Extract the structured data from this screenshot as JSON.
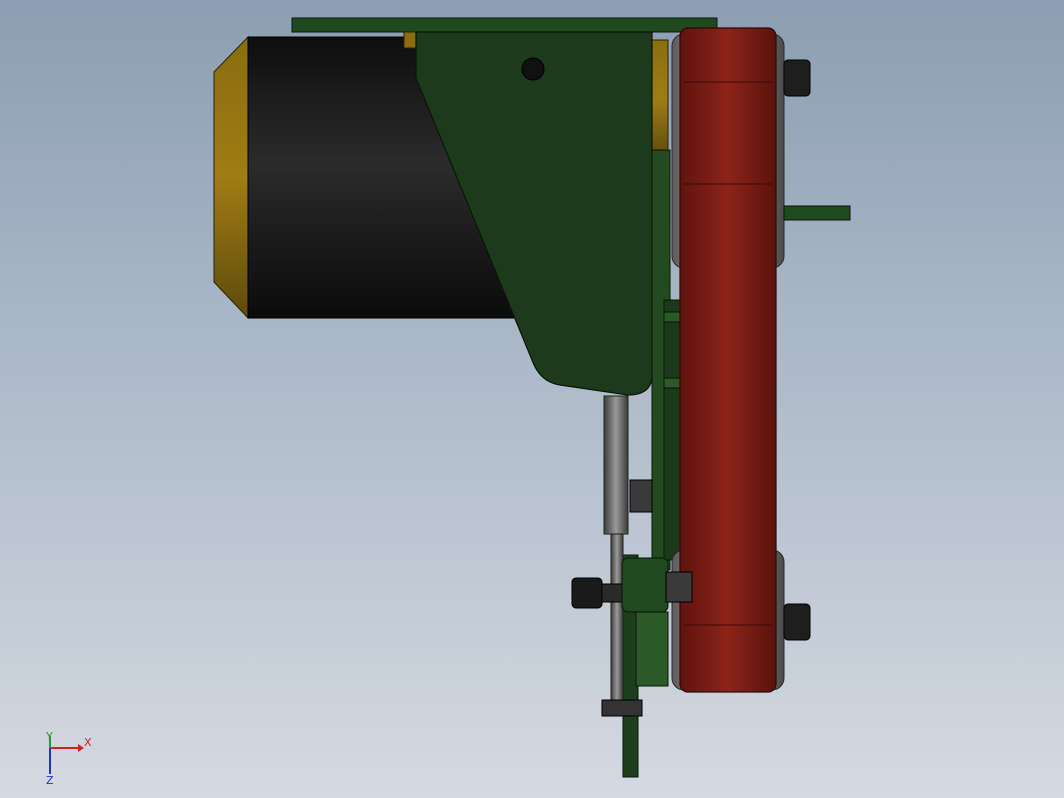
{
  "viewport": {
    "background_top": "#8c9eb3",
    "background_bottom": "#d4dae2"
  },
  "colors": {
    "motor_body": "#171717",
    "motor_cap": "#6e5a15",
    "bracket_green": "#1f3d1c",
    "belt_red": "#7a1f16",
    "pulley_gray": "#8a8a8a",
    "rod_gray": "#6a6a6a",
    "bolt_dark": "#2a2a2a"
  },
  "triad": {
    "x_label": "X",
    "y_label": "Y",
    "z_label": "Z",
    "x_color": "#d42020",
    "y_color": "#20a020",
    "z_color": "#2030c8"
  }
}
